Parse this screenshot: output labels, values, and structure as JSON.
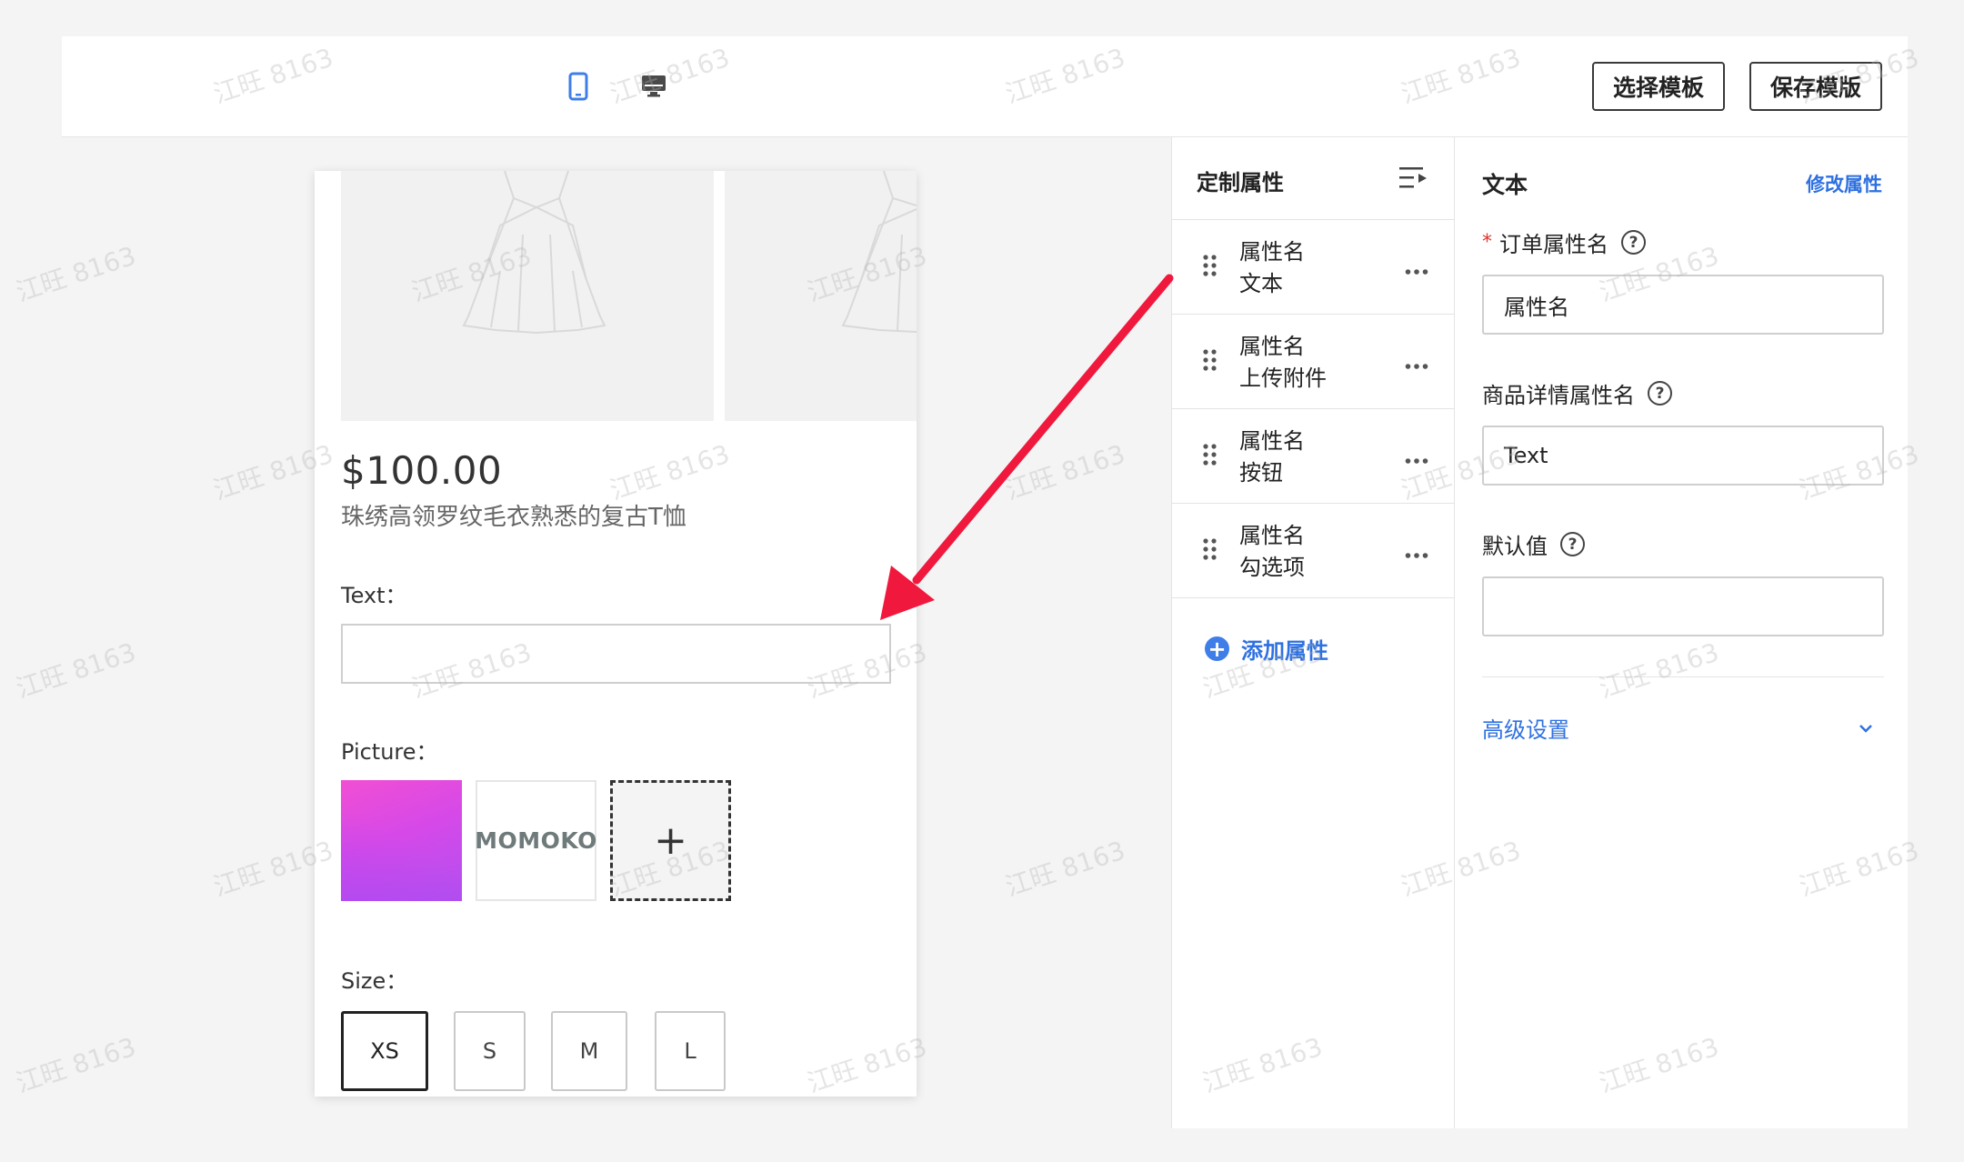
{
  "toolbar": {
    "select_template_label": "选择模板",
    "save_template_label": "保存模版",
    "mobile_icon": "mobile-device-icon",
    "desktop_icon": "desktop-monitor-icon"
  },
  "preview": {
    "price": "$100.00",
    "product_title": "珠绣高领罗纹毛衣熟悉的复古T恤",
    "text_label": "Text：",
    "picture_label": "Picture：",
    "thumb_brand": "MOMOKO",
    "add_symbol": "+",
    "size_label": "Size：",
    "sizes": [
      "XS",
      "S",
      "M",
      "L"
    ],
    "selected_size": "XS"
  },
  "attributes": {
    "title": "定制属性",
    "items": [
      {
        "name": "属性名",
        "type": "文本"
      },
      {
        "name": "属性名",
        "type": "上传附件"
      },
      {
        "name": "属性名",
        "type": "按钮"
      },
      {
        "name": "属性名",
        "type": "勾选项"
      }
    ],
    "add_label": "添加属性"
  },
  "properties": {
    "title": "文本",
    "edit_link": "修改属性",
    "order_attr_label": "订单属性名",
    "order_attr_value": "属性名",
    "detail_attr_label": "商品详情属性名",
    "detail_attr_value": "Text",
    "default_label": "默认值",
    "default_value": "",
    "help_symbol": "?",
    "required_mark": "*",
    "advanced_label": "高级设置"
  },
  "watermark": "江旺 8163",
  "colors": {
    "accent_blue": "#2f71e0",
    "annotation_arrow": "#f0193d",
    "required_red": "#e0342f"
  }
}
